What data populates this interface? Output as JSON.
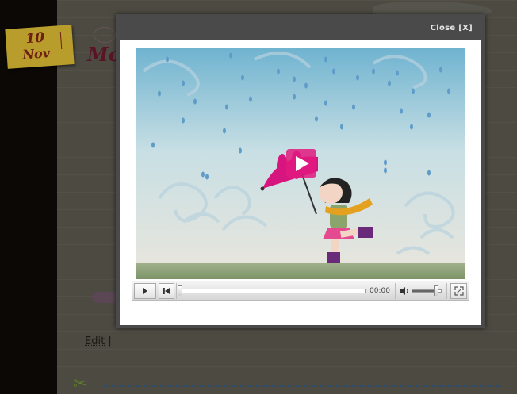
{
  "background": {
    "date": {
      "day": "10",
      "month": "Nov"
    },
    "title_fragment": "Mo",
    "edit_link": "Edit",
    "edit_separator": "|"
  },
  "lightbox": {
    "close_label": "Close [X]",
    "player": {
      "time": "00:00",
      "progress": 0,
      "volume": 0.8
    }
  },
  "icons": {
    "play": "play-icon",
    "skip_back": "skip-back-icon",
    "volume": "speaker-icon",
    "fullscreen": "fullscreen-icon",
    "scissors": "scissors-icon"
  }
}
